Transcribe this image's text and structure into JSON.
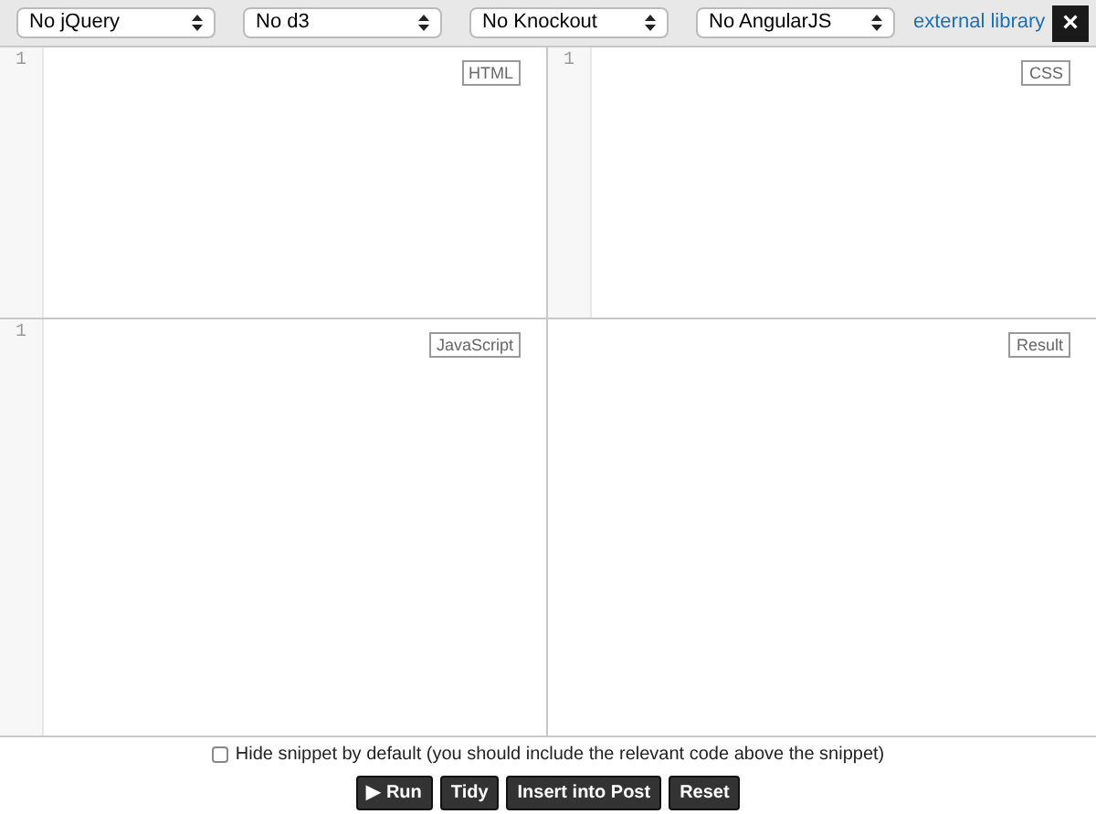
{
  "toolbar": {
    "selects": [
      {
        "value": "No jQuery"
      },
      {
        "value": "No d3"
      },
      {
        "value": "No Knockout"
      },
      {
        "value": "No AngularJS"
      }
    ],
    "link": "external library",
    "close": "×"
  },
  "panels": [
    {
      "kind": "editor",
      "line_number": "1",
      "label": "HTML"
    },
    {
      "kind": "editor",
      "line_number": "1",
      "label": "CSS"
    },
    {
      "kind": "editor",
      "line_number": "1",
      "label": "JavaScript"
    },
    {
      "kind": "result",
      "label": "Result"
    }
  ],
  "hide_snippet": {
    "label": "Hide snippet by default (you should include the relevant code above the snippet)",
    "checked": false
  },
  "buttons": [
    "▶ Run",
    "Tidy",
    "Insert into Post",
    "Reset"
  ]
}
